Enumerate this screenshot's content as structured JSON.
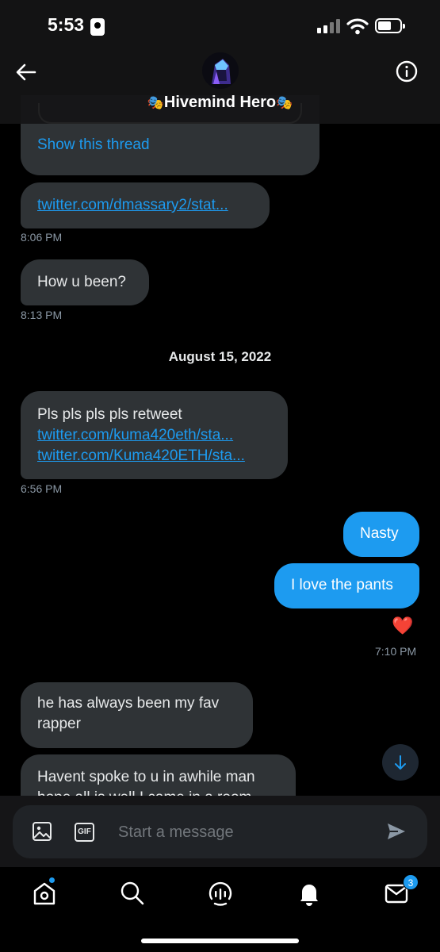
{
  "status_bar": {
    "time": "5:53"
  },
  "header": {
    "title": "Hivemind Hero",
    "title_decoration": "🎭",
    "back_icon": "arrow-left-icon",
    "info_icon": "info-icon"
  },
  "messages": {
    "thread_link": "Show this thread",
    "m1_link": "twitter.com/dmassary2/stat...",
    "m1_time": "8:06 PM",
    "m2_text": "How u been?",
    "m2_time": "8:13 PM",
    "date_separator": "August 15, 2022",
    "m3_line1": "Pls pls pls pls retweet",
    "m3_link1": "twitter.com/kuma420eth/sta...",
    "m3_link2": "twitter.com/Kuma420ETH/sta...",
    "m3_time": "6:56 PM",
    "s1_text": "Nasty",
    "s2_text": "I love the pants",
    "s2_reaction": "❤️",
    "s_time": "7:10 PM",
    "m4_line1": "he has always been my fav",
    "m4_line2": "rapper",
    "m5_line1": "Havent spoke to u in awhile man",
    "m5_line2": "hope all is well I came in a room"
  },
  "composer": {
    "placeholder": "Start a message",
    "image_icon": "image-icon",
    "gif_label": "GIF",
    "send_icon": "send-icon"
  },
  "nav": {
    "items": [
      "home-icon",
      "search-icon",
      "spaces-icon",
      "notifications-icon",
      "messages-icon"
    ],
    "messages_badge": "3"
  },
  "colors": {
    "accent": "#1d9bf0",
    "received_bubble": "#2f3336",
    "background": "#000000"
  }
}
